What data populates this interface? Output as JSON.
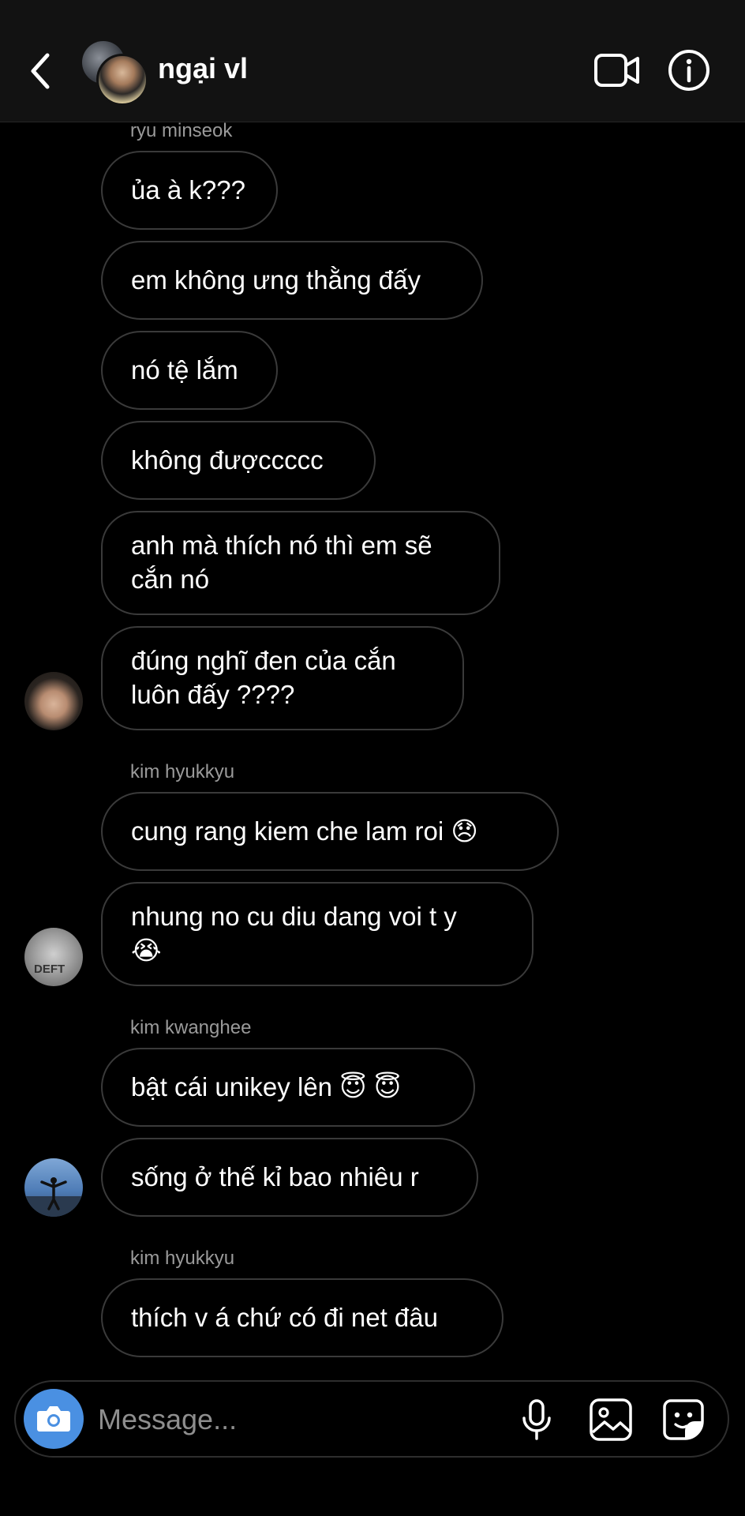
{
  "header": {
    "title": "ngại vl",
    "back_icon": "chevron-left-icon",
    "video_icon": "video-camera-icon",
    "info_icon": "info-icon"
  },
  "messages": {
    "g1_sender": "ryu minseok",
    "g1": [
      "ủa à k???",
      "em không ưng thằng đấy",
      "nó tệ lắm",
      "không đượccccc",
      "anh mà thích nó thì em sẽ",
      "cắn nó",
      "đúng nghĩ đen của cắn",
      "luôn đấy ????"
    ],
    "g2_sender": "kim hyukkyu",
    "g2": [
      "cung rang kiem che lam roi 😞",
      "nhung no cu diu dang voi t y",
      "😭"
    ],
    "g3_sender": "kim kwanghee",
    "g3": [
      "bật cái unikey lên 😇 😇",
      "sống ở thế kỉ bao nhiêu r"
    ],
    "g4_sender": "kim hyukkyu",
    "g4": [
      "thích v á chứ có đi net đâu"
    ],
    "avatar_kim_text": "DEFT"
  },
  "composer": {
    "placeholder": "Message...",
    "camera_icon": "camera-icon",
    "mic_icon": "microphone-icon",
    "gallery_icon": "image-gallery-icon",
    "sticker_icon": "sticker-icon"
  },
  "colors": {
    "header_bg": "#121212",
    "bubble_border": "#3a3a3a",
    "camera_button": "#4a90e2",
    "sender_text": "#9a9a9a"
  }
}
